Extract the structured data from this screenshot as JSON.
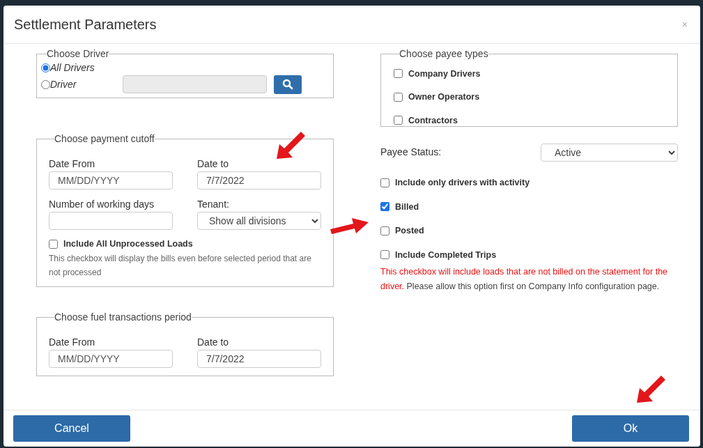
{
  "dialog": {
    "title": "Settlement Parameters",
    "close": "×"
  },
  "choose_driver": {
    "legend": "Choose Driver",
    "options": [
      {
        "label": "All Drivers",
        "selected": true
      },
      {
        "label": "Driver",
        "selected": false
      }
    ]
  },
  "payment_cutoff": {
    "legend": "Choose payment cutoff",
    "date_from": {
      "label": "Date From",
      "placeholder": "MM/DD/YYYY"
    },
    "date_to": {
      "label": "Date to",
      "value": "7/7/2022"
    },
    "working_days": {
      "label": "Number of working days"
    },
    "tenant": {
      "label": "Tenant:",
      "value": "Show all divisions"
    },
    "unprocessed": {
      "label": "Include All Unprocessed Loads",
      "checked": false
    },
    "note": "This checkbox will display the bills even before selected period that are not processed"
  },
  "fuel_period": {
    "legend": "Choose fuel transactions period",
    "date_from": {
      "label": "Date From",
      "placeholder": "MM/DD/YYYY"
    },
    "date_to": {
      "label": "Date to",
      "value": "7/7/2022"
    }
  },
  "payee_types": {
    "legend": "Choose payee types",
    "items": [
      {
        "label": "Company Drivers",
        "checked": false
      },
      {
        "label": "Owner Operators",
        "checked": false
      },
      {
        "label": "Contractors",
        "checked": false
      }
    ]
  },
  "payee_status": {
    "label": "Payee Status:",
    "value": "Active"
  },
  "options": [
    {
      "label": "Include only drivers with activity",
      "checked": false
    },
    {
      "label": "Billed",
      "checked": true
    },
    {
      "label": "Posted",
      "checked": false
    },
    {
      "label": "Include Completed Trips",
      "checked": false
    }
  ],
  "completed_note": {
    "warning": "This checkbox will include loads that are not billed on the statement for the driver.",
    "text": " Please allow this option first on Company Info configuration page."
  },
  "buttons": {
    "cancel": "Cancel",
    "ok": "Ok"
  }
}
